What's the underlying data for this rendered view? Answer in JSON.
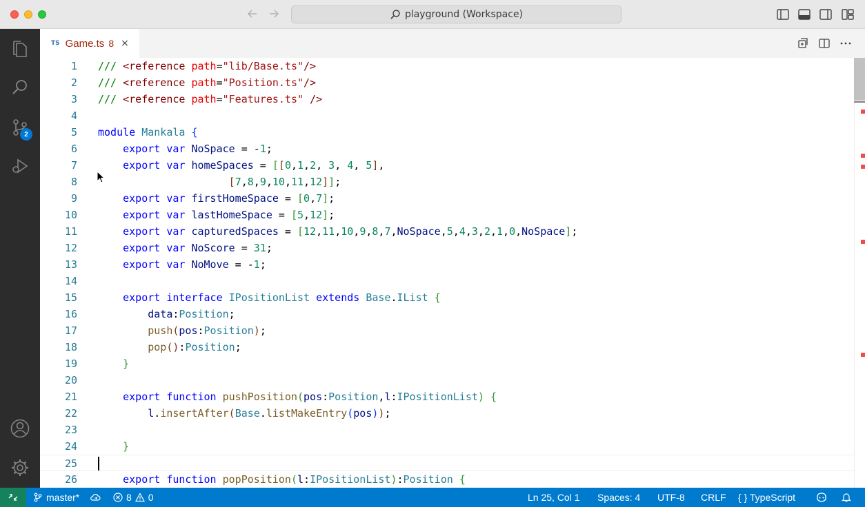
{
  "window": {
    "command_center": "playground (Workspace)"
  },
  "activity": {
    "scm_badge": "2"
  },
  "tab": {
    "lang": "TS",
    "name": "Game.ts",
    "problems": "8",
    "close": "×"
  },
  "editor": {
    "lines": [
      {
        "n": "1",
        "tokens": [
          [
            "cm",
            "/// "
          ],
          [
            "tag",
            "<reference "
          ],
          [
            "attr",
            "path"
          ],
          [
            "p",
            "="
          ],
          [
            "str",
            "\"lib/Base.ts\""
          ],
          [
            "tag",
            "/>"
          ]
        ]
      },
      {
        "n": "2",
        "tokens": [
          [
            "cm",
            "/// "
          ],
          [
            "tag",
            "<reference "
          ],
          [
            "attr",
            "path"
          ],
          [
            "p",
            "="
          ],
          [
            "str",
            "\"Position.ts\""
          ],
          [
            "tag",
            "/>"
          ]
        ]
      },
      {
        "n": "3",
        "tokens": [
          [
            "cm",
            "/// "
          ],
          [
            "tag",
            "<reference "
          ],
          [
            "attr",
            "path"
          ],
          [
            "p",
            "="
          ],
          [
            "str",
            "\"Features.ts\""
          ],
          [
            "p",
            " "
          ],
          [
            "tag",
            "/>"
          ]
        ]
      },
      {
        "n": "4",
        "tokens": []
      },
      {
        "n": "5",
        "tokens": [
          [
            "kw",
            "module "
          ],
          [
            "ty",
            "Mankala "
          ],
          [
            "b1",
            "{"
          ]
        ]
      },
      {
        "n": "6",
        "tokens": [
          [
            "p",
            "    "
          ],
          [
            "kw",
            "export "
          ],
          [
            "kw",
            "var "
          ],
          [
            "var",
            "NoSpace"
          ],
          [
            "p",
            " = -"
          ],
          [
            "num",
            "1"
          ],
          [
            "p",
            ";"
          ]
        ]
      },
      {
        "n": "7",
        "tokens": [
          [
            "p",
            "    "
          ],
          [
            "kw",
            "export "
          ],
          [
            "kw",
            "var "
          ],
          [
            "var",
            "homeSpaces"
          ],
          [
            "p",
            " = "
          ],
          [
            "b2",
            "["
          ],
          [
            "b3",
            "["
          ],
          [
            "num",
            "0"
          ],
          [
            "p",
            ","
          ],
          [
            "num",
            "1"
          ],
          [
            "p",
            ","
          ],
          [
            "num",
            "2"
          ],
          [
            "p",
            ", "
          ],
          [
            "num",
            "3"
          ],
          [
            "p",
            ", "
          ],
          [
            "num",
            "4"
          ],
          [
            "p",
            ", "
          ],
          [
            "num",
            "5"
          ],
          [
            "b3",
            "]"
          ],
          [
            "p",
            ","
          ]
        ]
      },
      {
        "n": "8",
        "tokens": [
          [
            "p",
            "                     "
          ],
          [
            "b3",
            "["
          ],
          [
            "num",
            "7"
          ],
          [
            "p",
            ","
          ],
          [
            "num",
            "8"
          ],
          [
            "p",
            ","
          ],
          [
            "num",
            "9"
          ],
          [
            "p",
            ","
          ],
          [
            "num",
            "10"
          ],
          [
            "p",
            ","
          ],
          [
            "num",
            "11"
          ],
          [
            "p",
            ","
          ],
          [
            "num",
            "12"
          ],
          [
            "b3",
            "]"
          ],
          [
            "b2",
            "]"
          ],
          [
            "p",
            ";"
          ]
        ]
      },
      {
        "n": "9",
        "tokens": [
          [
            "p",
            "    "
          ],
          [
            "kw",
            "export "
          ],
          [
            "kw",
            "var "
          ],
          [
            "var",
            "firstHomeSpace"
          ],
          [
            "p",
            " = "
          ],
          [
            "b2",
            "["
          ],
          [
            "num",
            "0"
          ],
          [
            "p",
            ","
          ],
          [
            "num",
            "7"
          ],
          [
            "b2",
            "]"
          ],
          [
            "p",
            ";"
          ]
        ]
      },
      {
        "n": "10",
        "tokens": [
          [
            "p",
            "    "
          ],
          [
            "kw",
            "export "
          ],
          [
            "kw",
            "var "
          ],
          [
            "var",
            "lastHomeSpace"
          ],
          [
            "p",
            " = "
          ],
          [
            "b2",
            "["
          ],
          [
            "num",
            "5"
          ],
          [
            "p",
            ","
          ],
          [
            "num",
            "12"
          ],
          [
            "b2",
            "]"
          ],
          [
            "p",
            ";"
          ]
        ]
      },
      {
        "n": "11",
        "tokens": [
          [
            "p",
            "    "
          ],
          [
            "kw",
            "export "
          ],
          [
            "kw",
            "var "
          ],
          [
            "var",
            "capturedSpaces"
          ],
          [
            "p",
            " = "
          ],
          [
            "b2",
            "["
          ],
          [
            "num",
            "12"
          ],
          [
            "p",
            ","
          ],
          [
            "num",
            "11"
          ],
          [
            "p",
            ","
          ],
          [
            "num",
            "10"
          ],
          [
            "p",
            ","
          ],
          [
            "num",
            "9"
          ],
          [
            "p",
            ","
          ],
          [
            "num",
            "8"
          ],
          [
            "p",
            ","
          ],
          [
            "num",
            "7"
          ],
          [
            "p",
            ","
          ],
          [
            "var",
            "NoSpace"
          ],
          [
            "p",
            ","
          ],
          [
            "num",
            "5"
          ],
          [
            "p",
            ","
          ],
          [
            "num",
            "4"
          ],
          [
            "p",
            ","
          ],
          [
            "num",
            "3"
          ],
          [
            "p",
            ","
          ],
          [
            "num",
            "2"
          ],
          [
            "p",
            ","
          ],
          [
            "num",
            "1"
          ],
          [
            "p",
            ","
          ],
          [
            "num",
            "0"
          ],
          [
            "p",
            ","
          ],
          [
            "var",
            "NoSpace"
          ],
          [
            "b2",
            "]"
          ],
          [
            "p",
            ";"
          ]
        ]
      },
      {
        "n": "12",
        "tokens": [
          [
            "p",
            "    "
          ],
          [
            "kw",
            "export "
          ],
          [
            "kw",
            "var "
          ],
          [
            "var",
            "NoScore"
          ],
          [
            "p",
            " = "
          ],
          [
            "num",
            "31"
          ],
          [
            "p",
            ";"
          ]
        ]
      },
      {
        "n": "13",
        "tokens": [
          [
            "p",
            "    "
          ],
          [
            "kw",
            "export "
          ],
          [
            "kw",
            "var "
          ],
          [
            "var",
            "NoMove"
          ],
          [
            "p",
            " = -"
          ],
          [
            "num",
            "1"
          ],
          [
            "p",
            ";"
          ]
        ]
      },
      {
        "n": "14",
        "tokens": []
      },
      {
        "n": "15",
        "tokens": [
          [
            "p",
            "    "
          ],
          [
            "kw",
            "export "
          ],
          [
            "kw",
            "interface "
          ],
          [
            "ty",
            "IPositionList "
          ],
          [
            "kw",
            "extends "
          ],
          [
            "ty",
            "Base"
          ],
          [
            "p",
            "."
          ],
          [
            "ty",
            "IList "
          ],
          [
            "b2",
            "{"
          ]
        ]
      },
      {
        "n": "16",
        "tokens": [
          [
            "p",
            "        "
          ],
          [
            "var",
            "data"
          ],
          [
            "p",
            ":"
          ],
          [
            "ty",
            "Position"
          ],
          [
            "p",
            ";"
          ]
        ]
      },
      {
        "n": "17",
        "tokens": [
          [
            "p",
            "        "
          ],
          [
            "fn",
            "push"
          ],
          [
            "b3",
            "("
          ],
          [
            "var",
            "pos"
          ],
          [
            "p",
            ":"
          ],
          [
            "ty",
            "Position"
          ],
          [
            "b3",
            ")"
          ],
          [
            "p",
            ";"
          ]
        ]
      },
      {
        "n": "18",
        "tokens": [
          [
            "p",
            "        "
          ],
          [
            "fn",
            "pop"
          ],
          [
            "b3",
            "()"
          ],
          [
            "p",
            ":"
          ],
          [
            "ty",
            "Position"
          ],
          [
            "p",
            ";"
          ]
        ]
      },
      {
        "n": "19",
        "tokens": [
          [
            "p",
            "    "
          ],
          [
            "b2",
            "}"
          ]
        ]
      },
      {
        "n": "20",
        "tokens": []
      },
      {
        "n": "21",
        "tokens": [
          [
            "p",
            "    "
          ],
          [
            "kw",
            "export "
          ],
          [
            "kw",
            "function "
          ],
          [
            "fn",
            "pushPosition"
          ],
          [
            "b2",
            "("
          ],
          [
            "var",
            "pos"
          ],
          [
            "p",
            ":"
          ],
          [
            "ty",
            "Position"
          ],
          [
            "p",
            ","
          ],
          [
            "var",
            "l"
          ],
          [
            "p",
            ":"
          ],
          [
            "ty",
            "IPositionList"
          ],
          [
            "b2",
            ")"
          ],
          [
            "p",
            " "
          ],
          [
            "b2",
            "{"
          ]
        ]
      },
      {
        "n": "22",
        "tokens": [
          [
            "p",
            "        "
          ],
          [
            "var",
            "l"
          ],
          [
            "p",
            "."
          ],
          [
            "fn",
            "insertAfter"
          ],
          [
            "b3",
            "("
          ],
          [
            "ty",
            "Base"
          ],
          [
            "p",
            "."
          ],
          [
            "fn",
            "listMakeEntry"
          ],
          [
            "b1",
            "("
          ],
          [
            "var",
            "pos"
          ],
          [
            "b1",
            ")"
          ],
          [
            "b3",
            ")"
          ],
          [
            "p",
            ";"
          ]
        ]
      },
      {
        "n": "23",
        "tokens": []
      },
      {
        "n": "24",
        "tokens": [
          [
            "p",
            "    "
          ],
          [
            "b2",
            "}"
          ]
        ]
      },
      {
        "n": "25",
        "tokens": []
      },
      {
        "n": "26",
        "tokens": [
          [
            "p",
            "    "
          ],
          [
            "kw",
            "export "
          ],
          [
            "kw",
            "function "
          ],
          [
            "fn",
            "popPosition"
          ],
          [
            "b2",
            "("
          ],
          [
            "var",
            "l"
          ],
          [
            "p",
            ":"
          ],
          [
            "ty",
            "IPositionList"
          ],
          [
            "b2",
            ")"
          ],
          [
            "p",
            ":"
          ],
          [
            "ty",
            "Position"
          ],
          [
            "p",
            " "
          ],
          [
            "b2",
            "{"
          ]
        ]
      }
    ],
    "current_line": "25"
  },
  "status": {
    "branch": "master*",
    "errors": "8",
    "warnings": "0",
    "position": "Ln 25, Col 1",
    "spaces": "Spaces: 4",
    "encoding": "UTF-8",
    "eol": "CRLF",
    "language_mode": "{ } TypeScript"
  },
  "icons": {
    "explorer": "files-icon",
    "search": "search-icon",
    "scm": "source-control-icon",
    "debug": "run-debug-icon",
    "account": "account-icon",
    "settings": "gear-icon"
  }
}
